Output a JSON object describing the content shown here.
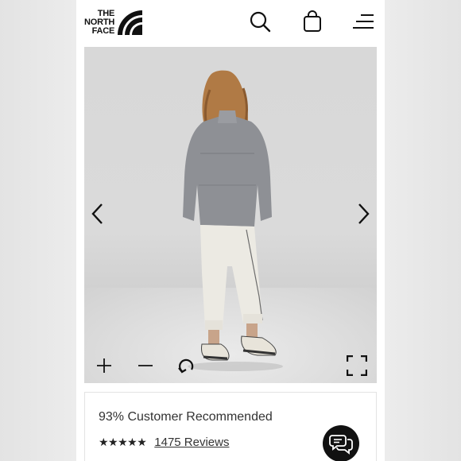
{
  "brand": {
    "line1": "THE",
    "line2": "NORTH",
    "line3": "FACE"
  },
  "header": {
    "search_icon": "search-icon",
    "bag_icon": "shopping-bag-icon",
    "menu_icon": "hamburger-menu-icon"
  },
  "gallery": {
    "prev_icon": "chevron-left-icon",
    "next_icon": "chevron-right-icon",
    "zoom_in_icon": "plus-icon",
    "zoom_out_icon": "minus-icon",
    "rotate_icon": "rotate-icon",
    "fullscreen_icon": "fullscreen-icon"
  },
  "product": {
    "recommend_text": "93% Customer Recommended",
    "stars": "★★★★★",
    "rating_stars": 5,
    "reviews_text": "1475 Reviews"
  },
  "chat": {
    "icon": "chat-bubbles-icon"
  }
}
